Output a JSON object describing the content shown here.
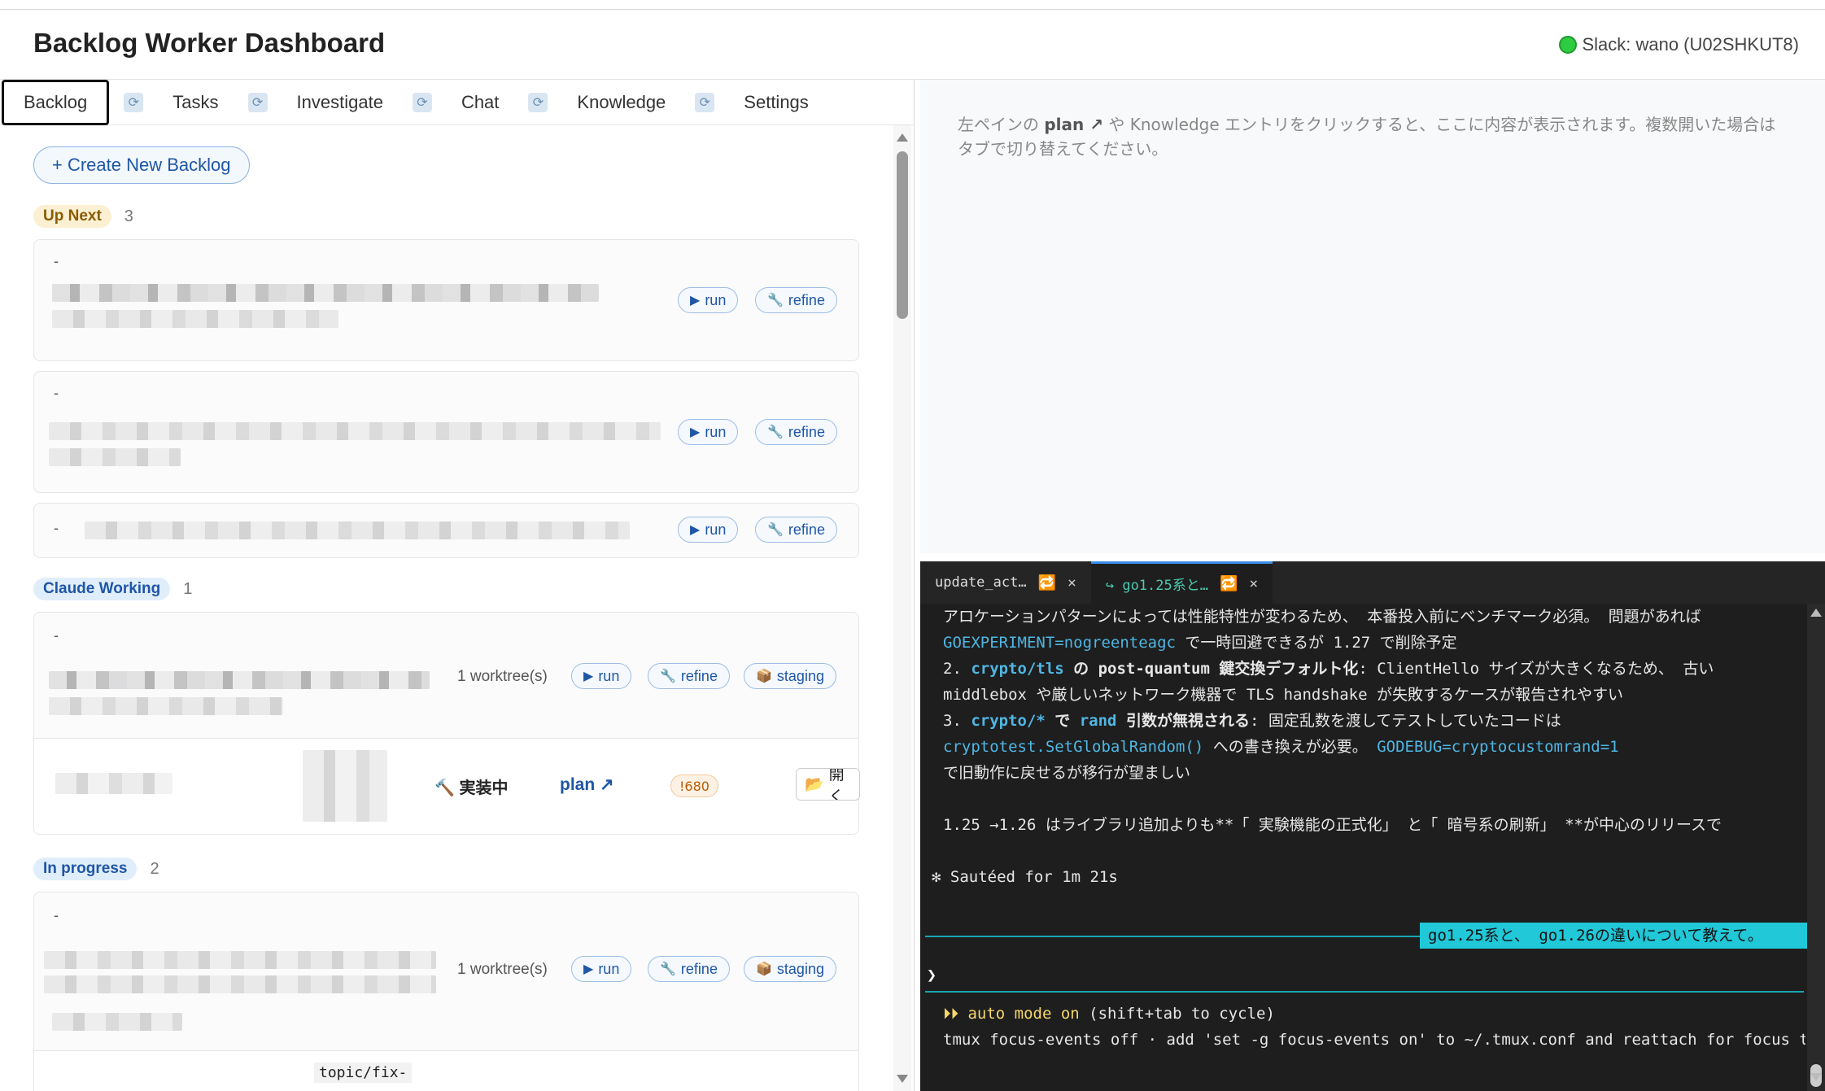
{
  "app": {
    "title": "Backlog Worker Dashboard",
    "slack_status": "Slack: wano (U02SHKUT8)"
  },
  "tabs": [
    {
      "label": "Backlog",
      "active": true
    },
    {
      "label": "Tasks"
    },
    {
      "label": "Investigate"
    },
    {
      "label": "Chat"
    },
    {
      "label": "Knowledge"
    },
    {
      "label": "Settings"
    }
  ],
  "backlog": {
    "create_label": "+ Create New Backlog",
    "sections": [
      {
        "label": "Up Next",
        "count": "3"
      },
      {
        "label": "Claude Working",
        "count": "1"
      },
      {
        "label": "In progress",
        "count": "2"
      }
    ],
    "card_dash": "-",
    "run_label": "run",
    "refine_label": "refine",
    "staging_label": "staging",
    "worktree_label": "1 worktree(s)",
    "impl_label": "🔨 実装中",
    "plan_label": "plan ↗",
    "mr_label": "!680",
    "open_label": "開く",
    "branch_label": "topic/fix-"
  },
  "viewer": {
    "hint_pre": "左ペインの ",
    "hint_plan": "plan ↗",
    "hint_post": " や Knowledge エントリをクリックすると、ここに内容が表示されます。複数開いた場合はタブで切り替えてください。"
  },
  "terminal": {
    "tabs": [
      {
        "label": "update_act…",
        "active": false
      },
      {
        "label": "↪ go1.25系と…",
        "active": true
      }
    ],
    "lines": {
      "l1": "アロケーションパターンによっては性能特性が変わるため、 本番投入前にベンチマーク必須。 問題があれば",
      "l2a": "GOEXPERIMENT=nogreenteagc",
      "l2b": " で一時回避できるが 1.27 で削除予定",
      "l3a": "2. ",
      "l3b": "crypto/tls",
      "l3c": " の ",
      "l3d": "post-quantum 鍵交換デフォルト化",
      "l3e": ": ClientHello サイズが大きくなるため、 古い",
      "l4": "middlebox や厳しいネットワーク機器で TLS handshake が失敗するケースが報告されやすい",
      "l5a": "3. ",
      "l5b": "crypto/*",
      "l5c": " で ",
      "l5d": "rand",
      "l5e": " 引数が無視される",
      "l5f": ": 固定乱数を渡してテストしていたコードは",
      "l6a": "cryptotest.SetGlobalRandom()",
      "l6b": " への書き換えが必要。 ",
      "l6c": "GODEBUG=cryptocustomrand=1",
      "l7": "で旧動作に戻せるが移行が望ましい",
      "l8": "1.25 →1.26 はライブラリ追加よりも**「 実験機能の正式化」 と「 暗号系の刷新」 **が中心のリリースで",
      "l9": "✻ Sautéed for 1m 21s",
      "prompt_msg": "go1.25系と、 go1.26の違いについて教えて。",
      "caret": "❯",
      "auto_a": "⏵⏵ auto mode on",
      "auto_b": " (shift+tab to cycle)",
      "tmux": "tmux focus-events off · add 'set -g focus-events on' to ~/.tmux.conf and reattach for focus tra…"
    }
  }
}
